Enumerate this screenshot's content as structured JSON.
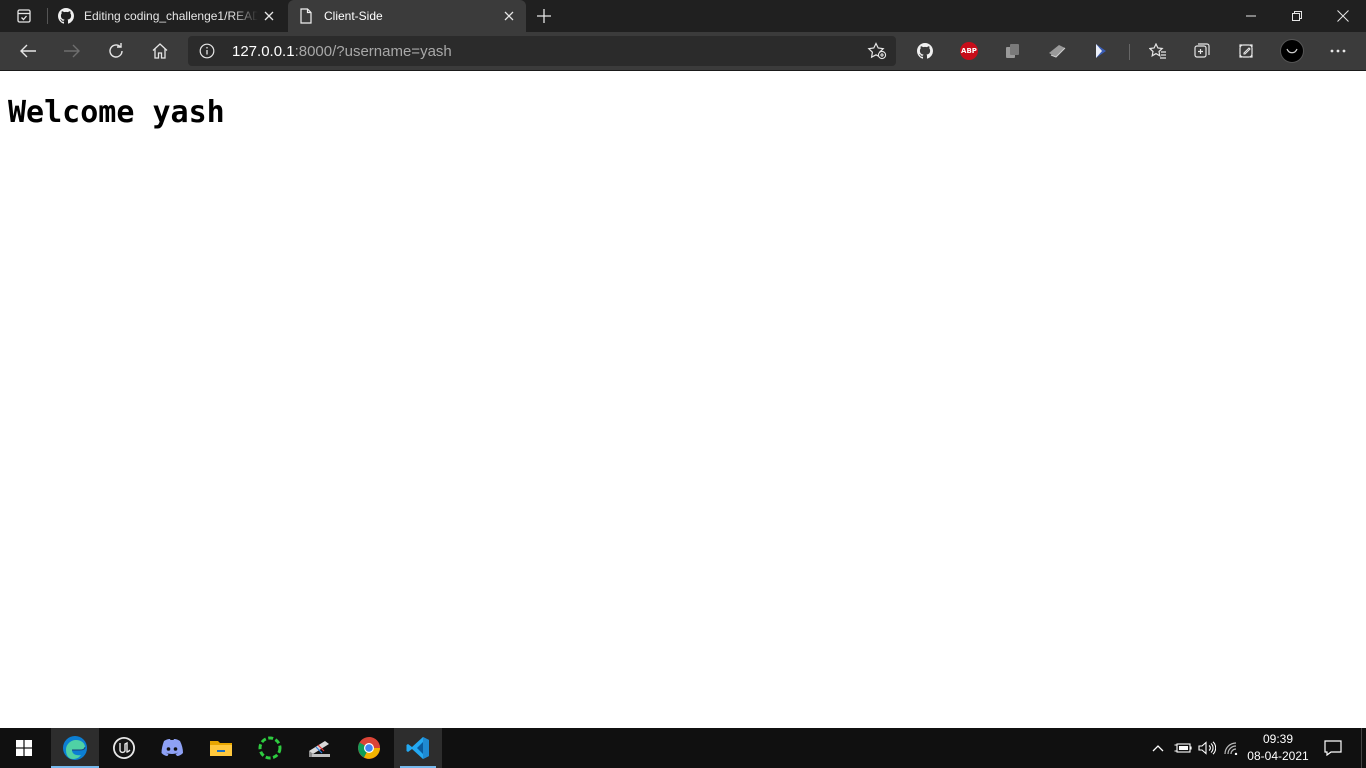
{
  "browser": {
    "tabs": [
      {
        "title": "Editing coding_challenge1/READ",
        "icon": "github-icon",
        "active": false
      },
      {
        "title": "Client-Side",
        "icon": "page-icon",
        "active": true
      }
    ],
    "address": {
      "host": "127.0.0.1",
      "rest": ":8000/?username=yash"
    },
    "extensions": [
      "github-icon",
      "adblock-plus-icon",
      "extension-icon",
      "extension-icon",
      "extension-icon"
    ],
    "abp_label": "ABP"
  },
  "page": {
    "heading": "Welcome yash"
  },
  "taskbar": {
    "apps": [
      "windows-start-icon",
      "edge-icon",
      "unreal-engine-icon",
      "discord-icon",
      "file-explorer-icon",
      "app-icon",
      "app-icon",
      "chrome-icon",
      "vscode-icon"
    ],
    "clock": {
      "time": "09:39",
      "date": "08-04-2021"
    }
  },
  "colors": {
    "tabstrip": "#202020",
    "toolbar": "#3b3b3b",
    "taskbar": "#101010",
    "accent": "#76b9ed"
  }
}
